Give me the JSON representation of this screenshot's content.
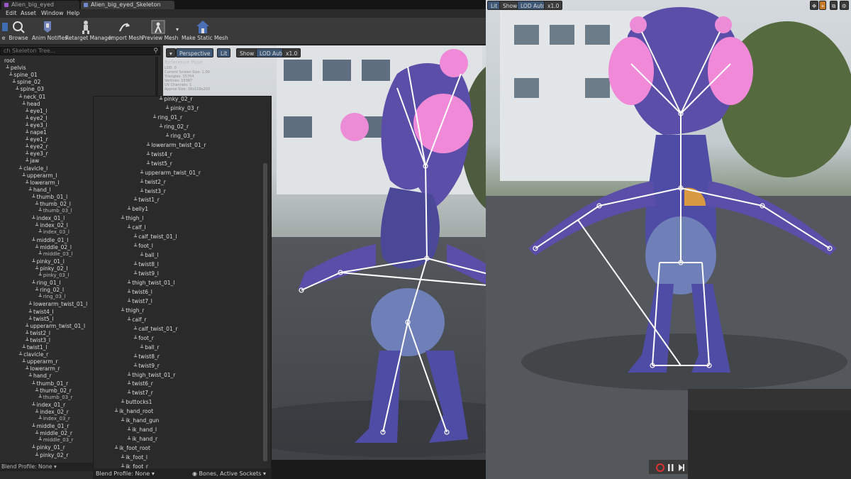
{
  "tabs": [
    {
      "label": "Alien_big_eyed",
      "active": false
    },
    {
      "label": "Alien_big_eyed_Skeleton",
      "active": true
    }
  ],
  "menu": [
    "Edit",
    "Asset",
    "Window",
    "Help"
  ],
  "toolbar": [
    {
      "label": "e",
      "icon": "save-icon"
    },
    {
      "label": "Browse",
      "icon": "browse-icon"
    },
    {
      "label": "Anim Notifies",
      "icon": "notify-icon"
    },
    {
      "label": "Retarget Manager",
      "icon": "retarget-icon"
    },
    {
      "label": "Import Mesh",
      "icon": "import-icon"
    },
    {
      "label": "Preview Mesh",
      "icon": "preview-mesh-icon"
    },
    {
      "label": "Make Static Mesh",
      "icon": "static-mesh-icon"
    }
  ],
  "skeleton_tree": {
    "search_placeholder": "ch Skeleton Tree...",
    "bones": [
      {
        "name": "root",
        "indent": 0
      },
      {
        "name": "pelvis",
        "indent": 1
      },
      {
        "name": "spine_01",
        "indent": 2
      },
      {
        "name": "spine_02",
        "indent": 3
      },
      {
        "name": "spine_03",
        "indent": 4
      },
      {
        "name": "neck_01",
        "indent": 5
      },
      {
        "name": "head",
        "indent": 6
      },
      {
        "name": "eye1_l",
        "indent": 7
      },
      {
        "name": "eye2_l",
        "indent": 7
      },
      {
        "name": "eye3_l",
        "indent": 7
      },
      {
        "name": "nape1",
        "indent": 7
      },
      {
        "name": "eye1_r",
        "indent": 7
      },
      {
        "name": "eye2_r",
        "indent": 7
      },
      {
        "name": "eye3_r",
        "indent": 7
      },
      {
        "name": "jaw",
        "indent": 7
      },
      {
        "name": "clavicle_l",
        "indent": 5
      },
      {
        "name": "upperarm_l",
        "indent": 6
      },
      {
        "name": "lowerarm_l",
        "indent": 7
      },
      {
        "name": "hand_l",
        "indent": 8
      },
      {
        "name": "thumb_01_l",
        "indent": 9
      },
      {
        "name": "thumb_02_l",
        "indent": 10
      },
      {
        "name": "thumb_03_l",
        "indent": 11
      },
      {
        "name": "index_01_l",
        "indent": 9
      },
      {
        "name": "index_02_l",
        "indent": 10
      },
      {
        "name": "index_03_l",
        "indent": 11
      },
      {
        "name": "middle_01_l",
        "indent": 9
      },
      {
        "name": "middle_02_l",
        "indent": 10
      },
      {
        "name": "middle_03_l",
        "indent": 11
      },
      {
        "name": "pinky_01_l",
        "indent": 9
      },
      {
        "name": "pinky_02_l",
        "indent": 10
      },
      {
        "name": "pinky_03_l",
        "indent": 11
      },
      {
        "name": "ring_01_l",
        "indent": 9
      },
      {
        "name": "ring_02_l",
        "indent": 10
      },
      {
        "name": "ring_03_l",
        "indent": 11
      },
      {
        "name": "lowerarm_twist_01_l",
        "indent": 8
      },
      {
        "name": "twist4_l",
        "indent": 8
      },
      {
        "name": "twist5_l",
        "indent": 8
      },
      {
        "name": "upperarm_twist_01_l",
        "indent": 7
      },
      {
        "name": "twist2_l",
        "indent": 7
      },
      {
        "name": "twist3_l",
        "indent": 7
      },
      {
        "name": "twist1_l",
        "indent": 6
      },
      {
        "name": "clavicle_r",
        "indent": 5
      },
      {
        "name": "upperarm_r",
        "indent": 6
      },
      {
        "name": "lowerarm_r",
        "indent": 7
      },
      {
        "name": "hand_r",
        "indent": 8
      },
      {
        "name": "thumb_01_r",
        "indent": 9
      },
      {
        "name": "thumb_02_r",
        "indent": 10
      },
      {
        "name": "thumb_03_r",
        "indent": 11
      },
      {
        "name": "index_01_r",
        "indent": 9
      },
      {
        "name": "index_02_r",
        "indent": 10
      },
      {
        "name": "index_03_r",
        "indent": 11
      },
      {
        "name": "middle_01_r",
        "indent": 9
      },
      {
        "name": "middle_02_r",
        "indent": 10
      },
      {
        "name": "middle_03_r",
        "indent": 11
      },
      {
        "name": "pinky_01_r",
        "indent": 9
      },
      {
        "name": "pinky_02_r",
        "indent": 10
      }
    ],
    "blend_profile": "Blend Profile: None"
  },
  "bone_list_panel": {
    "bones": [
      {
        "name": "pinky_02_r",
        "indent": 6
      },
      {
        "name": "pinky_03_r",
        "indent": 7
      },
      {
        "name": "ring_01_r",
        "indent": 5
      },
      {
        "name": "ring_02_r",
        "indent": 6
      },
      {
        "name": "ring_03_r",
        "indent": 7
      },
      {
        "name": "lowerarm_twist_01_r",
        "indent": 4
      },
      {
        "name": "twist4_r",
        "indent": 4
      },
      {
        "name": "twist5_r",
        "indent": 4
      },
      {
        "name": "upperarm_twist_01_r",
        "indent": 3
      },
      {
        "name": "twist2_r",
        "indent": 3
      },
      {
        "name": "twist3_r",
        "indent": 3
      },
      {
        "name": "twist1_r",
        "indent": 2
      },
      {
        "name": "belly1",
        "indent": 1
      },
      {
        "name": "thigh_l",
        "indent": 0
      },
      {
        "name": "calf_l",
        "indent": 1
      },
      {
        "name": "calf_twist_01_l",
        "indent": 2
      },
      {
        "name": "foot_l",
        "indent": 2
      },
      {
        "name": "ball_l",
        "indent": 3
      },
      {
        "name": "twist8_l",
        "indent": 2
      },
      {
        "name": "twist9_l",
        "indent": 2
      },
      {
        "name": "thigh_twist_01_l",
        "indent": 1
      },
      {
        "name": "twist6_l",
        "indent": 1
      },
      {
        "name": "twist7_l",
        "indent": 1
      },
      {
        "name": "thigh_r",
        "indent": 0
      },
      {
        "name": "calf_r",
        "indent": 1
      },
      {
        "name": "calf_twist_01_r",
        "indent": 2
      },
      {
        "name": "foot_r",
        "indent": 2
      },
      {
        "name": "ball_r",
        "indent": 3
      },
      {
        "name": "twist8_r",
        "indent": 2
      },
      {
        "name": "twist9_r",
        "indent": 2
      },
      {
        "name": "thigh_twist_01_r",
        "indent": 1
      },
      {
        "name": "twist6_r",
        "indent": 1
      },
      {
        "name": "twist7_r",
        "indent": 1
      },
      {
        "name": "buttocks1",
        "indent": 0
      },
      {
        "name": "ik_hand_root",
        "indent": -1
      },
      {
        "name": "ik_hand_gun",
        "indent": 0
      },
      {
        "name": "ik_hand_l",
        "indent": 1
      },
      {
        "name": "ik_hand_r",
        "indent": 1
      },
      {
        "name": "ik_foot_root",
        "indent": -1
      },
      {
        "name": "ik_foot_l",
        "indent": 0
      },
      {
        "name": "ik_foot_r",
        "indent": 0
      }
    ],
    "blend_profile": "Blend Profile: None",
    "display_mode": "Bones, Active Sockets"
  },
  "viewport_left": {
    "perspective": "Perspective",
    "lit": "Lit",
    "show": "Show",
    "lod": "LOD Auto",
    "speed": "x1.0",
    "reference_pose": "Reference Pose",
    "stats": [
      "LOD: 0",
      "Current Screen Size: 1.00",
      "Triangles: 35764",
      "Vertices: 19387",
      "UV Channels: 1",
      "Approx Size: 39x119x203"
    ]
  },
  "viewport_right": {
    "lit": "Lit",
    "show": "Show",
    "lod": "LOD Auto",
    "speed": "x1.0"
  },
  "colors": {
    "alien_body": "#5a4ea8",
    "alien_eye": "#f08ad8",
    "bone_line": "#ffffff",
    "accent_orange": "#e8a33a"
  }
}
